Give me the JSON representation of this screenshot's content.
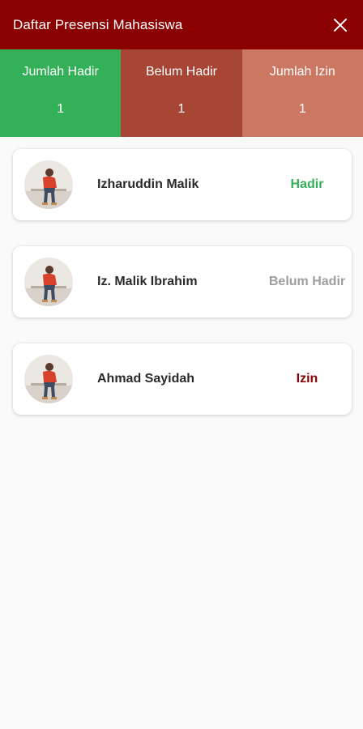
{
  "header": {
    "title": "Daftar Presensi Mahasiswa",
    "close_icon": "close-icon"
  },
  "summary": [
    {
      "label": "Jumlah Hadir",
      "count": "1",
      "color": "#34b158"
    },
    {
      "label": "Belum Hadir",
      "count": "1",
      "color": "#a84636"
    },
    {
      "label": "Jumlah Izin",
      "count": "1",
      "color": "#cb7863"
    }
  ],
  "students": [
    {
      "name": "Izharuddin Malik",
      "status": "Hadir",
      "status_color": "#34b158",
      "avatar_icon": "person-avatar"
    },
    {
      "name": "Iz. Malik Ibrahim",
      "status": "Belum Hadir",
      "status_color": "#9e9e9e",
      "avatar_icon": "person-avatar"
    },
    {
      "name": "Ahmad Sayidah",
      "status": "Izin",
      "status_color": "#8b0000",
      "avatar_icon": "person-avatar"
    }
  ],
  "colors": {
    "appbar": "#8b0000",
    "background": "#fafafa"
  }
}
